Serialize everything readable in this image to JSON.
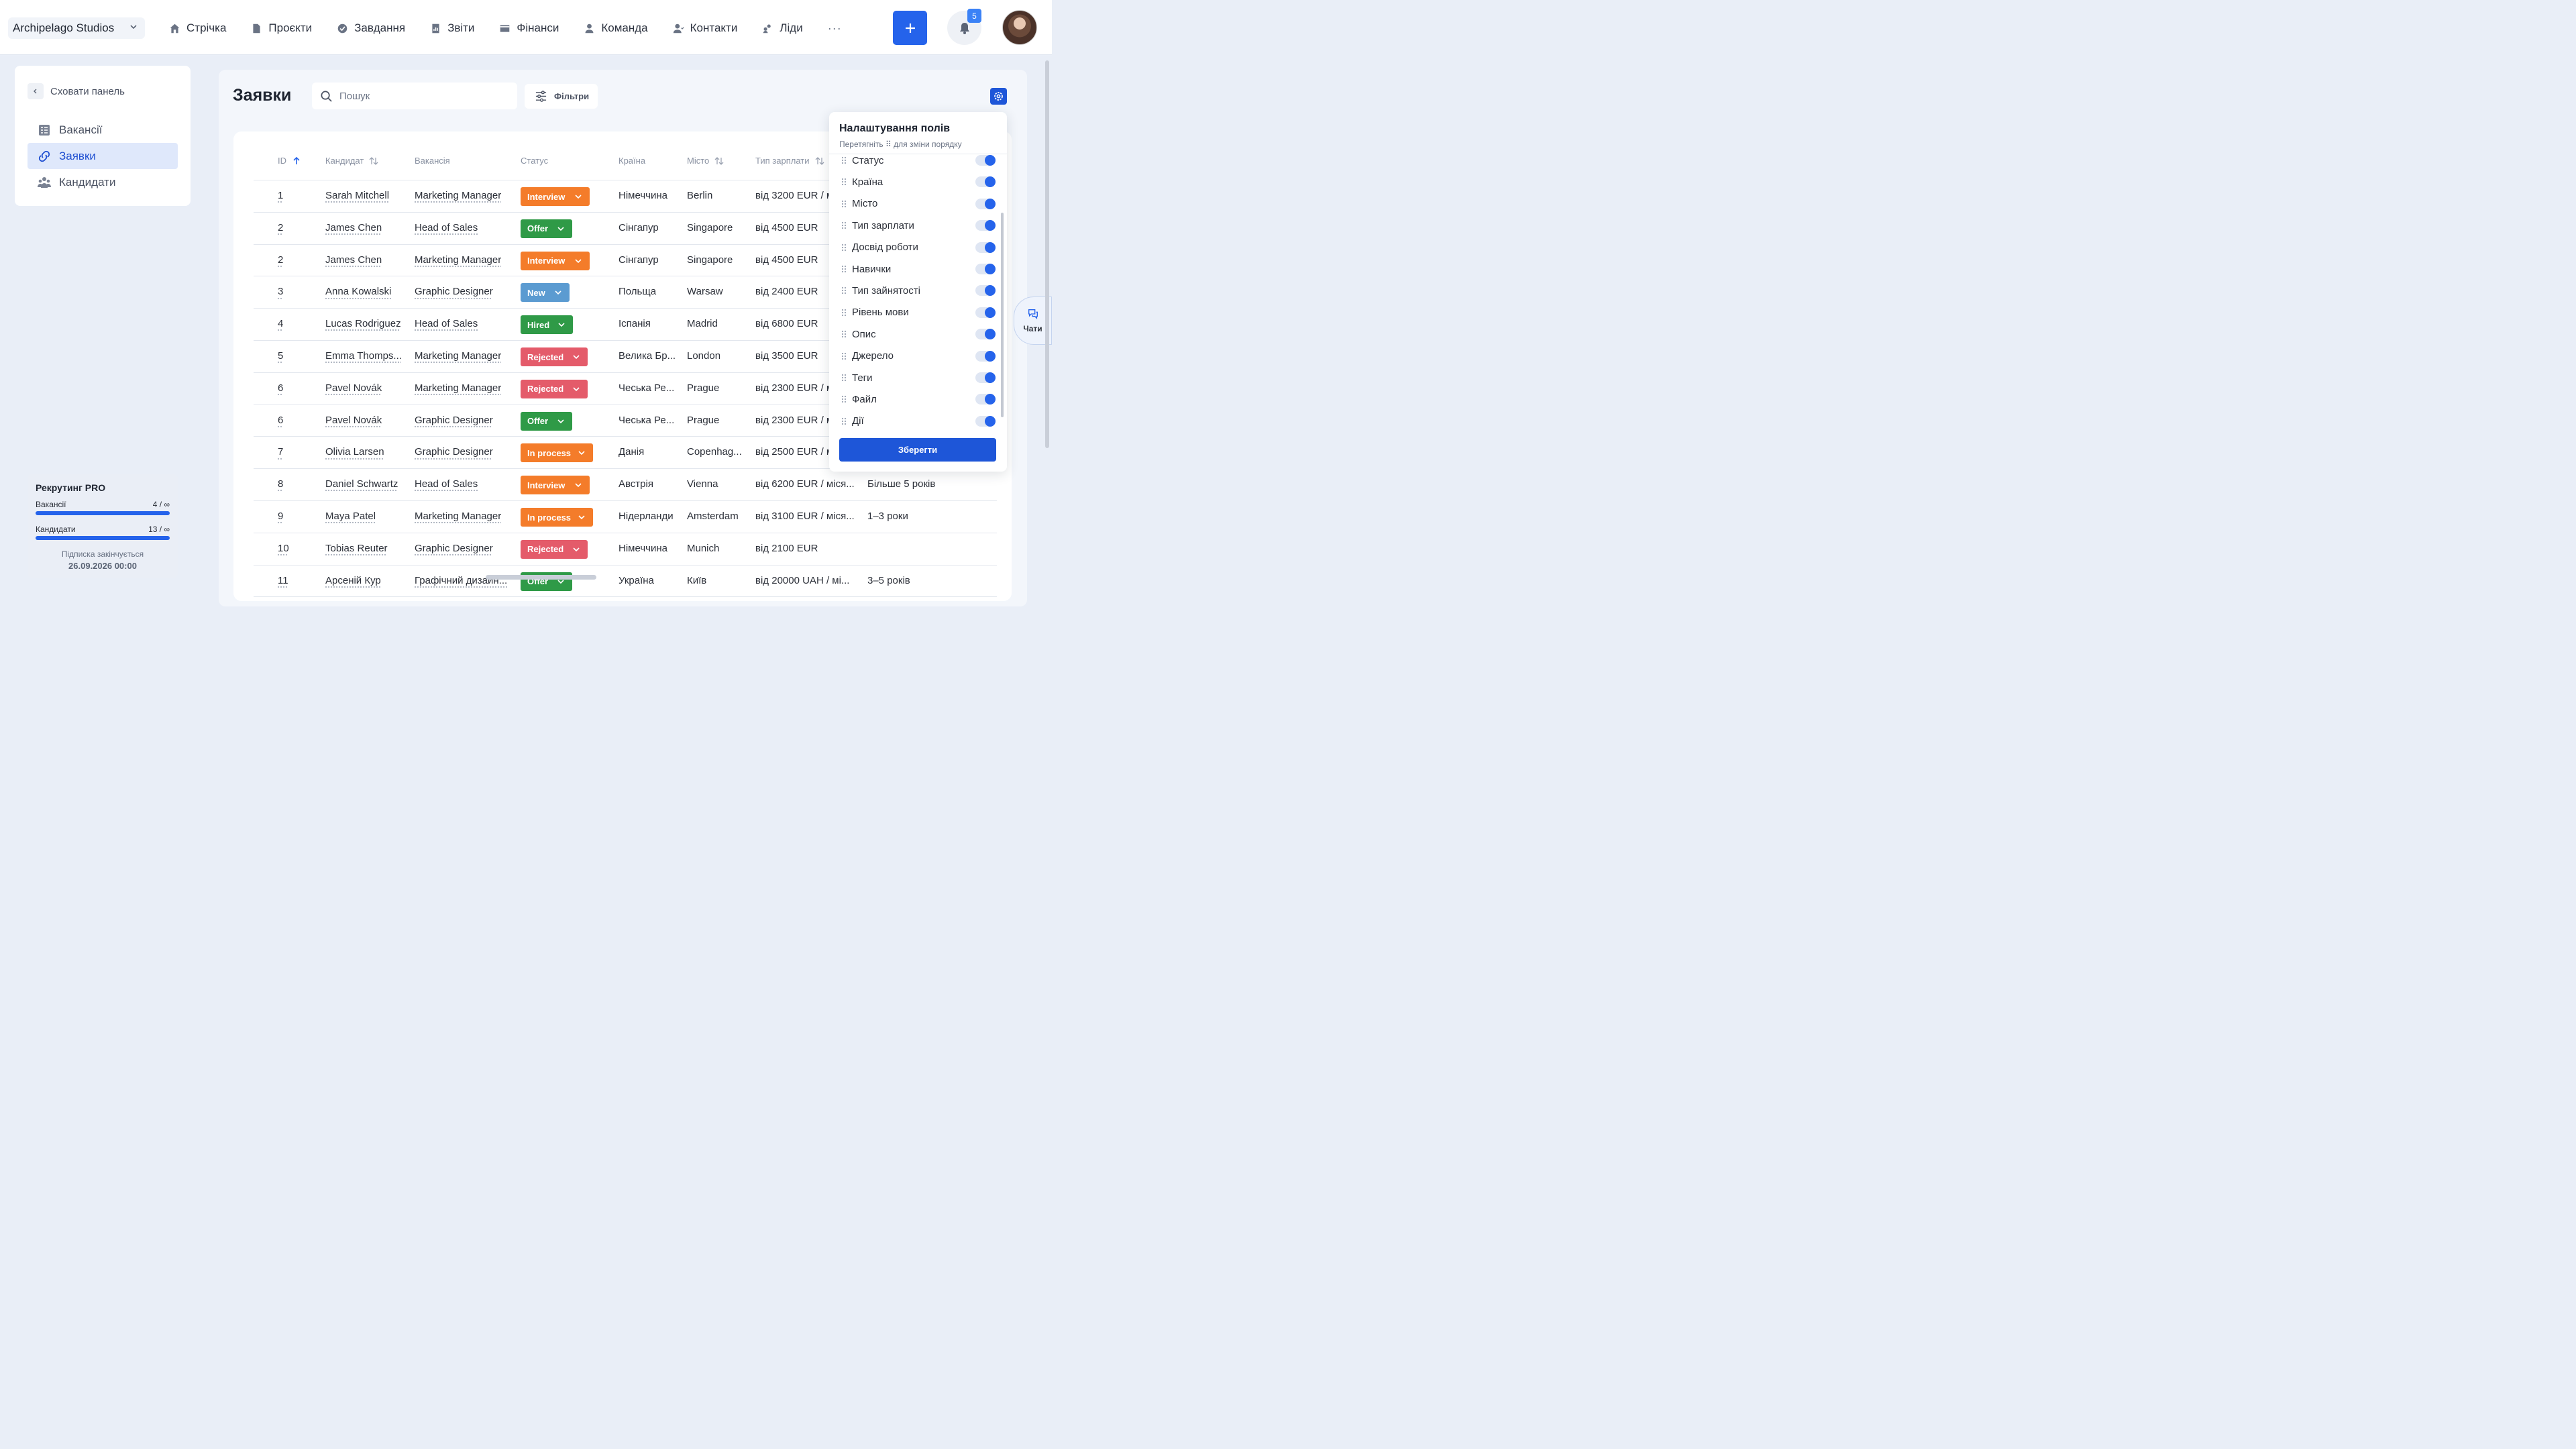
{
  "app": {
    "workspace": "Archipelago Studios",
    "nav": [
      "Стрічка",
      "Проєкти",
      "Завдання",
      "Звіти",
      "Фінанси",
      "Команда",
      "Контакти",
      "Ліди"
    ],
    "more": "···",
    "notifications": "5"
  },
  "sidebar": {
    "hide_label": "Сховати панель",
    "items": [
      "Вакансії",
      "Заявки",
      "Кандидати"
    ],
    "active": "Заявки",
    "plan": {
      "title": "Рекрутинг PRO",
      "vacancies_label": "Вакансії",
      "vacancies_value": "4 / ∞",
      "candidates_label": "Кандидати",
      "candidates_value": "13 / ∞",
      "expires_label": "Підписка закінчується",
      "expires_date": "26.09.2026 00:00"
    }
  },
  "main": {
    "title": "Заявки",
    "search_placeholder": "Пошук",
    "filters_label": "Фільтри",
    "columns": [
      "ID",
      "Кандидат",
      "Вакансія",
      "Статус",
      "Країна",
      "Місто",
      "Тип зарплати"
    ],
    "rows": [
      {
        "id": "1",
        "candidate": "Sarah Mitchell",
        "vacancy": "Marketing Manager",
        "status": "Interview",
        "country": "Німеччина",
        "city": "Berlin",
        "salary": "від 3200 EUR / м",
        "experience": ""
      },
      {
        "id": "2",
        "candidate": "James Chen",
        "vacancy": "Head of Sales",
        "status": "Offer",
        "country": "Сінгапур",
        "city": "Singapore",
        "salary": "від 4500 EUR",
        "experience": ""
      },
      {
        "id": "2",
        "candidate": "James Chen",
        "vacancy": "Marketing Manager",
        "status": "Interview",
        "country": "Сінгапур",
        "city": "Singapore",
        "salary": "від 4500 EUR",
        "experience": ""
      },
      {
        "id": "3",
        "candidate": "Anna Kowalski",
        "vacancy": "Graphic Designer",
        "status": "New",
        "country": "Польща",
        "city": "Warsaw",
        "salary": "від 2400 EUR",
        "experience": ""
      },
      {
        "id": "4",
        "candidate": "Lucas Rodriguez",
        "vacancy": "Head of Sales",
        "status": "Hired",
        "country": "Іспанія",
        "city": "Madrid",
        "salary": "від 6800 EUR",
        "experience": ""
      },
      {
        "id": "5",
        "candidate": "Emma Thomps...",
        "vacancy": "Marketing Manager",
        "status": "Rejected",
        "country": "Велика Бр...",
        "city": "London",
        "salary": "від 3500 EUR",
        "experience": ""
      },
      {
        "id": "6",
        "candidate": "Pavel Novák",
        "vacancy": "Marketing Manager",
        "status": "Rejected",
        "country": "Чеська Ре...",
        "city": "Prague",
        "salary": "від 2300 EUR / м",
        "experience": ""
      },
      {
        "id": "6",
        "candidate": "Pavel Novák",
        "vacancy": "Graphic Designer",
        "status": "Offer",
        "country": "Чеська Ре...",
        "city": "Prague",
        "salary": "від 2300 EUR / м",
        "experience": ""
      },
      {
        "id": "7",
        "candidate": "Olivia Larsen",
        "vacancy": "Graphic Designer",
        "status": "In process",
        "country": "Данія",
        "city": "Copenhag...",
        "salary": "від 2500 EUR / м",
        "experience": ""
      },
      {
        "id": "8",
        "candidate": "Daniel Schwartz",
        "vacancy": "Head of Sales",
        "status": "Interview",
        "country": "Австрія",
        "city": "Vienna",
        "salary": "від 6200 EUR / міся...",
        "experience": "Більше 5 років"
      },
      {
        "id": "9",
        "candidate": "Maya Patel",
        "vacancy": "Marketing Manager",
        "status": "In process",
        "country": "Нідерланди",
        "city": "Amsterdam",
        "salary": "від 3100 EUR / міся...",
        "experience": "1–3 роки"
      },
      {
        "id": "10",
        "candidate": "Tobias Reuter",
        "vacancy": "Graphic Designer",
        "status": "Rejected",
        "country": "Німеччина",
        "city": "Munich",
        "salary": "від 2100 EUR",
        "experience": ""
      },
      {
        "id": "11",
        "candidate": "Арсеній Кур",
        "vacancy": "Графічний дизайн...",
        "status": "Offer",
        "country": "Україна",
        "city": "Київ",
        "salary": "від 20000 UAH / мі...",
        "experience": "3–5 років"
      }
    ],
    "status_colors": {
      "Interview": "#f47c2a",
      "Offer": "#2f9a47",
      "New": "#5b9bd1",
      "Hired": "#2f9a47",
      "Rejected": "#e45b6a",
      "In process": "#f47c2a"
    }
  },
  "field_settings": {
    "title": "Налаштування полів",
    "subtitle": "Перетягніть ⠿ для зміни порядку",
    "fields": [
      "Статус",
      "Країна",
      "Місто",
      "Тип зарплати",
      "Досвід роботи",
      "Навички",
      "Тип зайнятості",
      "Рівень мови",
      "Опис",
      "Джерело",
      "Теги",
      "Файл",
      "Дії"
    ],
    "save_label": "Зберегти"
  },
  "chat": {
    "label": "Чати"
  }
}
